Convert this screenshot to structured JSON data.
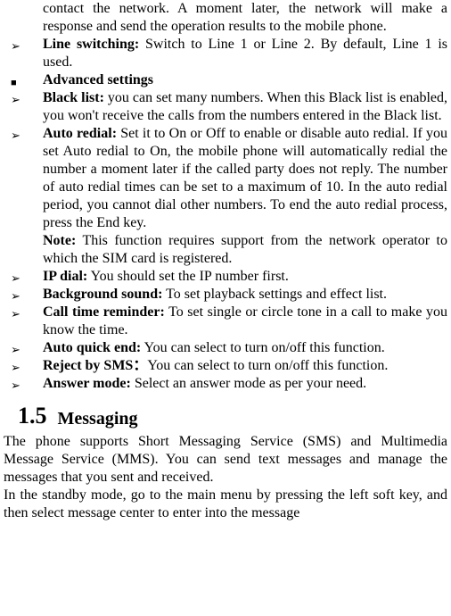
{
  "top_fragment": "contact the network. A moment later, the network will make a response and send the operation results to the mobile phone.",
  "line_switching_bold": "Line switching:",
  "line_switching_text": " Switch to Line 1 or Line 2. By default, Line 1 is used.",
  "advanced_settings": "Advanced settings",
  "black_list_bold": "Black list:",
  "black_list_text": " you can set many numbers. When this Black list is enabled, you won't receive the calls from the numbers entered in the Black list.",
  "auto_redial_bold": "Auto redial:",
  "auto_redial_text": " Set it to On or Off to enable or disable auto redial. If you set Auto redial to On, the mobile phone will automatically redial the number a moment later if the called party does not reply. The number of auto redial times can be set to a maximum of 10. In the auto redial period, you cannot dial other numbers. To end the auto redial process, press the End key.",
  "note_bold": "Note:",
  "note_text": " This function requires support from the network operator to which the SIM card is registered.",
  "ip_dial_bold": "IP dial:",
  "ip_dial_text": " You should set the IP number first.",
  "bg_sound_bold": "Background sound:",
  "bg_sound_text": " To set playback settings and effect list.",
  "call_time_bold": "Call time reminder:",
  "call_time_text": " To set single or circle tone in a call to make you know the time.",
  "auto_quick_bold": "Auto quick end:",
  "auto_quick_text": " You can select to turn on/off this function.",
  "reject_sms_bold": "Reject by SMS：",
  "reject_sms_text": "You can select to turn on/off this function.",
  "answer_mode_bold": "Answer mode:",
  "answer_mode_text": " Select an answer mode as per your need.",
  "section_number": "1.5",
  "section_name": "Messaging",
  "messaging_para1": "The phone supports Short Messaging Service (SMS) and Multimedia Message Service (MMS). You can send text messages and manage the messages that you sent and received.",
  "messaging_para2": "In the standby mode, go to the main menu by pressing the left soft key, and then select message center to enter into the message"
}
